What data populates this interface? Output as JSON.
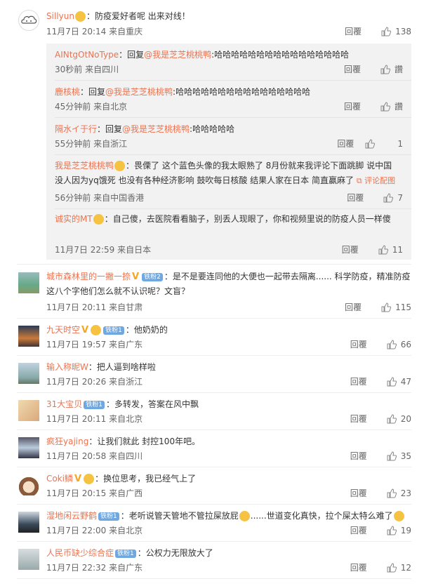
{
  "comments": [
    {
      "user": "Sillyun",
      "text": "：防疫爱好者呢 出来对线！",
      "time": "11月7日 20:14 来自重庆",
      "reply": "回覆",
      "likes": "138"
    },
    {
      "user": "城市森林里的一撇一捺",
      "badge": "铁粉2",
      "text": "：是不是要连同他的大便也一起带去隔离...... 科学防疫，精准防疫这八个字他们怎么就不认识呢？文盲？",
      "time": "11月7日 20:11 来自甘肃",
      "reply": "回覆",
      "likes": "115"
    },
    {
      "user": "九天时空",
      "badge": "铁粉1",
      "text": "：他奶奶的",
      "time": "11月7日 19:57 来自广东",
      "reply": "回覆",
      "likes": "66"
    },
    {
      "user": "输入称昵W",
      "text": "：把人逼到啥样啦",
      "time": "11月7日 20:26 来自浙江",
      "reply": "回覆",
      "likes": "47"
    },
    {
      "user": "31大宝贝",
      "badge": "铁粉1",
      "text": "：多转发，答案在风中飘",
      "time": "11月7日 20:11 来自北京",
      "reply": "回覆",
      "likes": "20"
    },
    {
      "user": "疯狂yajing",
      "text": "：让我们就此 封控100年吧。",
      "time": "11月7日 20:58 来自四川",
      "reply": "回覆",
      "likes": "35"
    },
    {
      "user": "Coki鳞",
      "text": "：换位思考，我已经气上了",
      "time": "11月7日 20:15 来自广西",
      "reply": "回覆",
      "likes": "23"
    },
    {
      "user": "湿地闲云野鹤",
      "badge": "铁粉1",
      "text": "：老听说管天管地不管拉屎放屁",
      "text2": "......世道变化真快，拉个屎太特么难了",
      "time": "11月7日 22:00 来自北京",
      "reply": "回覆",
      "likes": "19"
    },
    {
      "user": "人民币缺少综合症",
      "badge": "铁粉1",
      "text": "：公权力无限放大了",
      "time": "11月7日 22:32 来自广东",
      "reply": "回覆",
      "likes": "12"
    }
  ],
  "replies": [
    {
      "user": "AINtgOtNoType",
      "prefix": "：回复",
      "mention": "@我是芝芝桃桃鸭",
      "text": ":哈哈哈哈哈哈哈哈哈哈哈哈哈哈哈哈",
      "time": "30秒前 来自四川",
      "reply": "回覆",
      "likes": "讚"
    },
    {
      "user": "鹿核桃",
      "prefix": "：回复",
      "mention": "@我是芝芝桃桃鸭",
      "text": ":哈哈哈哈哈哈哈哈哈哈哈哈哈哈哈哈",
      "time": "45分钟前 来自北京",
      "reply": "回覆",
      "likes": "讚"
    },
    {
      "user": "隔水イ于行",
      "prefix": "：回复",
      "mention": "@我是芝芝桃桃鸭",
      "text": ":哈哈哈哈哈",
      "time": "55分钟前 来自浙江",
      "reply": "回覆",
      "likes": "1"
    },
    {
      "user": "我是芝芝桃桃鸭",
      "text": "：畏傈了 这个蓝色头像的我太眼熟了 8月份就来我评论下面跳脚 说中国没人因为yq饿死 也没有各种经济影响 鼓吹每日核酸 结果人家在日本 简直赢麻了",
      "report": "评论配图",
      "time": "56分钟前 来自中国香港",
      "reply": "回覆",
      "likes": "7"
    },
    {
      "user": "诚实的MT",
      "text": "：自己傻，去医院看看脑子，别丢人现眼了，你和视频里说的防疫人员一样傻",
      "time": "11月7日 22:59 来自日本",
      "reply": "回覆",
      "likes": "11"
    }
  ],
  "colors": {
    "username": "#eb7350",
    "meta": "#666666",
    "badge": "#6fa7e0",
    "vip": "#f5a623"
  }
}
